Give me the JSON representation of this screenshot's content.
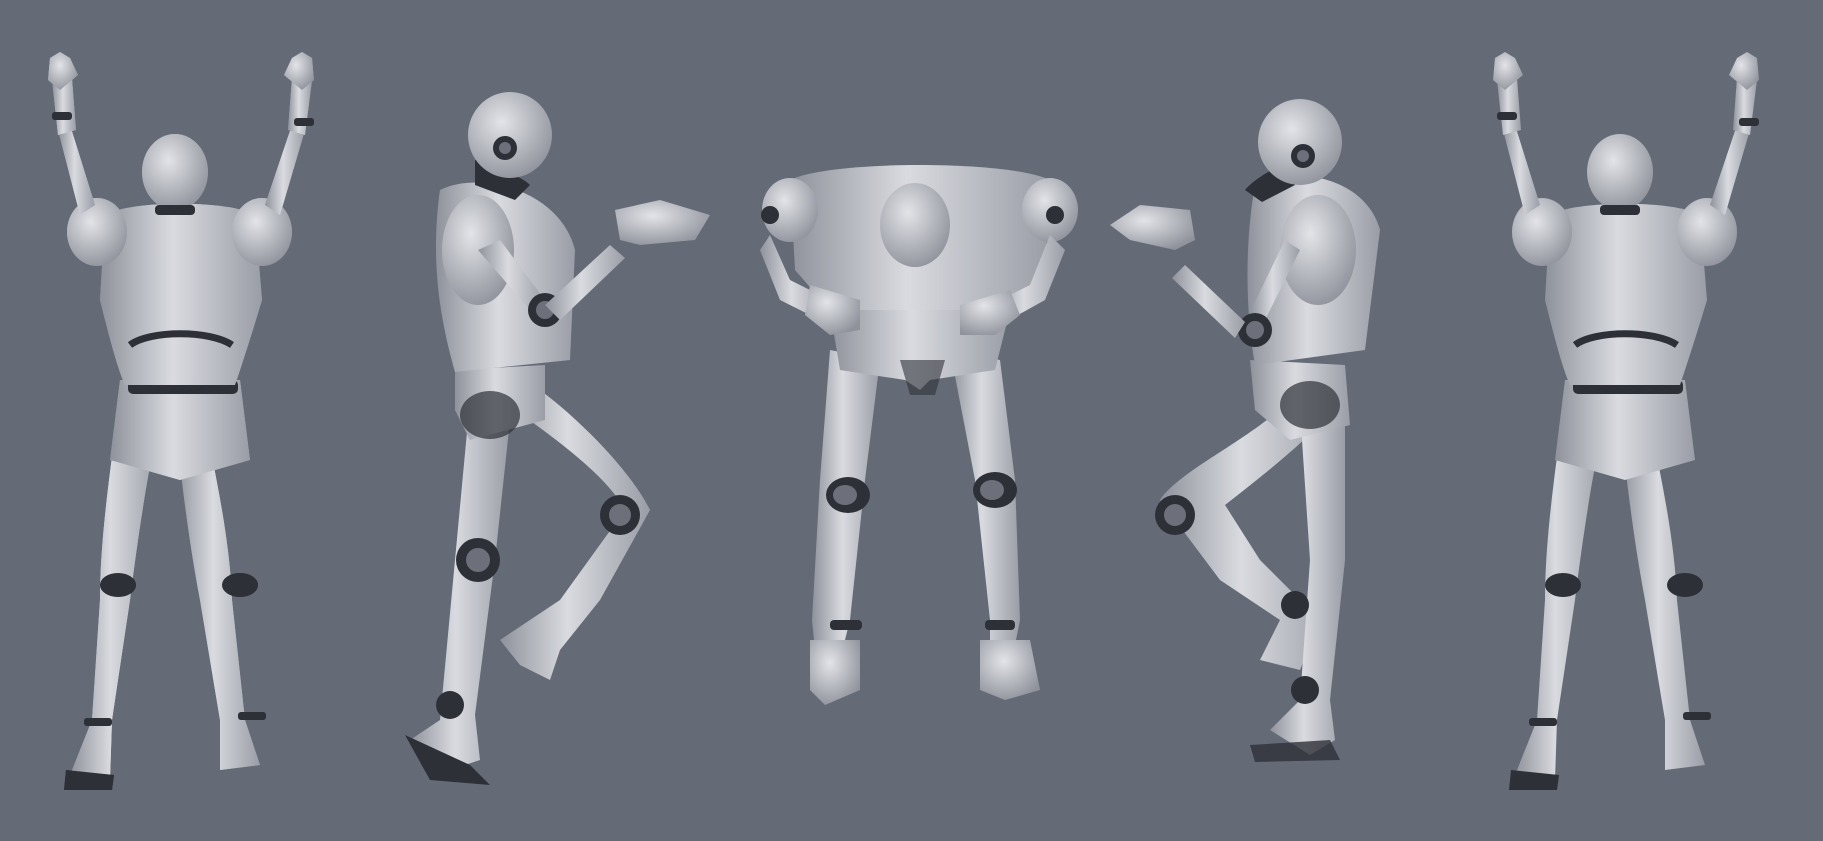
{
  "scene": {
    "background": "#646b77",
    "colors": {
      "shell": "#b9bcc4",
      "shell_light": "#d9dbe0",
      "shell_shadow": "#8f929b",
      "joint": "#2e3038"
    },
    "figures": [
      {
        "pose": "arms-raised-back-view"
      },
      {
        "pose": "side-step-clapping-left"
      },
      {
        "pose": "bent-forward-hands-on-knees-headless"
      },
      {
        "pose": "side-step-clapping-right"
      },
      {
        "pose": "arms-raised-back-view"
      }
    ]
  }
}
